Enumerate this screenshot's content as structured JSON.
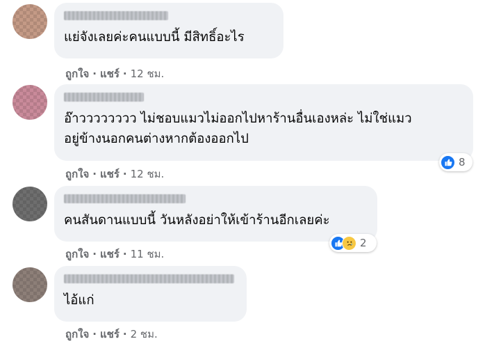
{
  "comments": [
    {
      "text": "แย่จังเลยค่ะคนแบบนี้ มีสิทธิ์อะไร",
      "actions": {
        "like": "ถูกใจ",
        "reply": "แชร์",
        "time": "12 ชม."
      }
    },
    {
      "text": "อ๊าวววววววว ไม่ชอบแมวไม่ออกไปหาร้านอื่นเองหล่ะ ไม่ใช่แมว\nอยู่ข้างนอกคนต่างหากต้องออกไป",
      "actions": {
        "like": "ถูกใจ",
        "reply": "แชร์",
        "time": "12 ชม."
      },
      "reactions": {
        "icons": [
          "like-icon"
        ],
        "count": "8"
      }
    },
    {
      "text": "คนสันดานแบบนี้ วันหลังอย่าให้เข้าร้านอีกเลยค่ะ",
      "actions": {
        "like": "ถูกใจ",
        "reply": "แชร์",
        "time": "11 ชม."
      },
      "reactions": {
        "icons": [
          "like-icon",
          "sad-icon"
        ],
        "count": "2"
      }
    },
    {
      "text": "ไอ้แก่",
      "actions": {
        "like": "ถูกใจ",
        "reply": "แชร์",
        "time": "2 ชม."
      }
    }
  ],
  "separator": "·",
  "colors": {
    "bubble": "#f0f2f5",
    "text": "#050505",
    "meta": "#65676b",
    "like": "#1877f2",
    "sad": "#f7c843"
  }
}
